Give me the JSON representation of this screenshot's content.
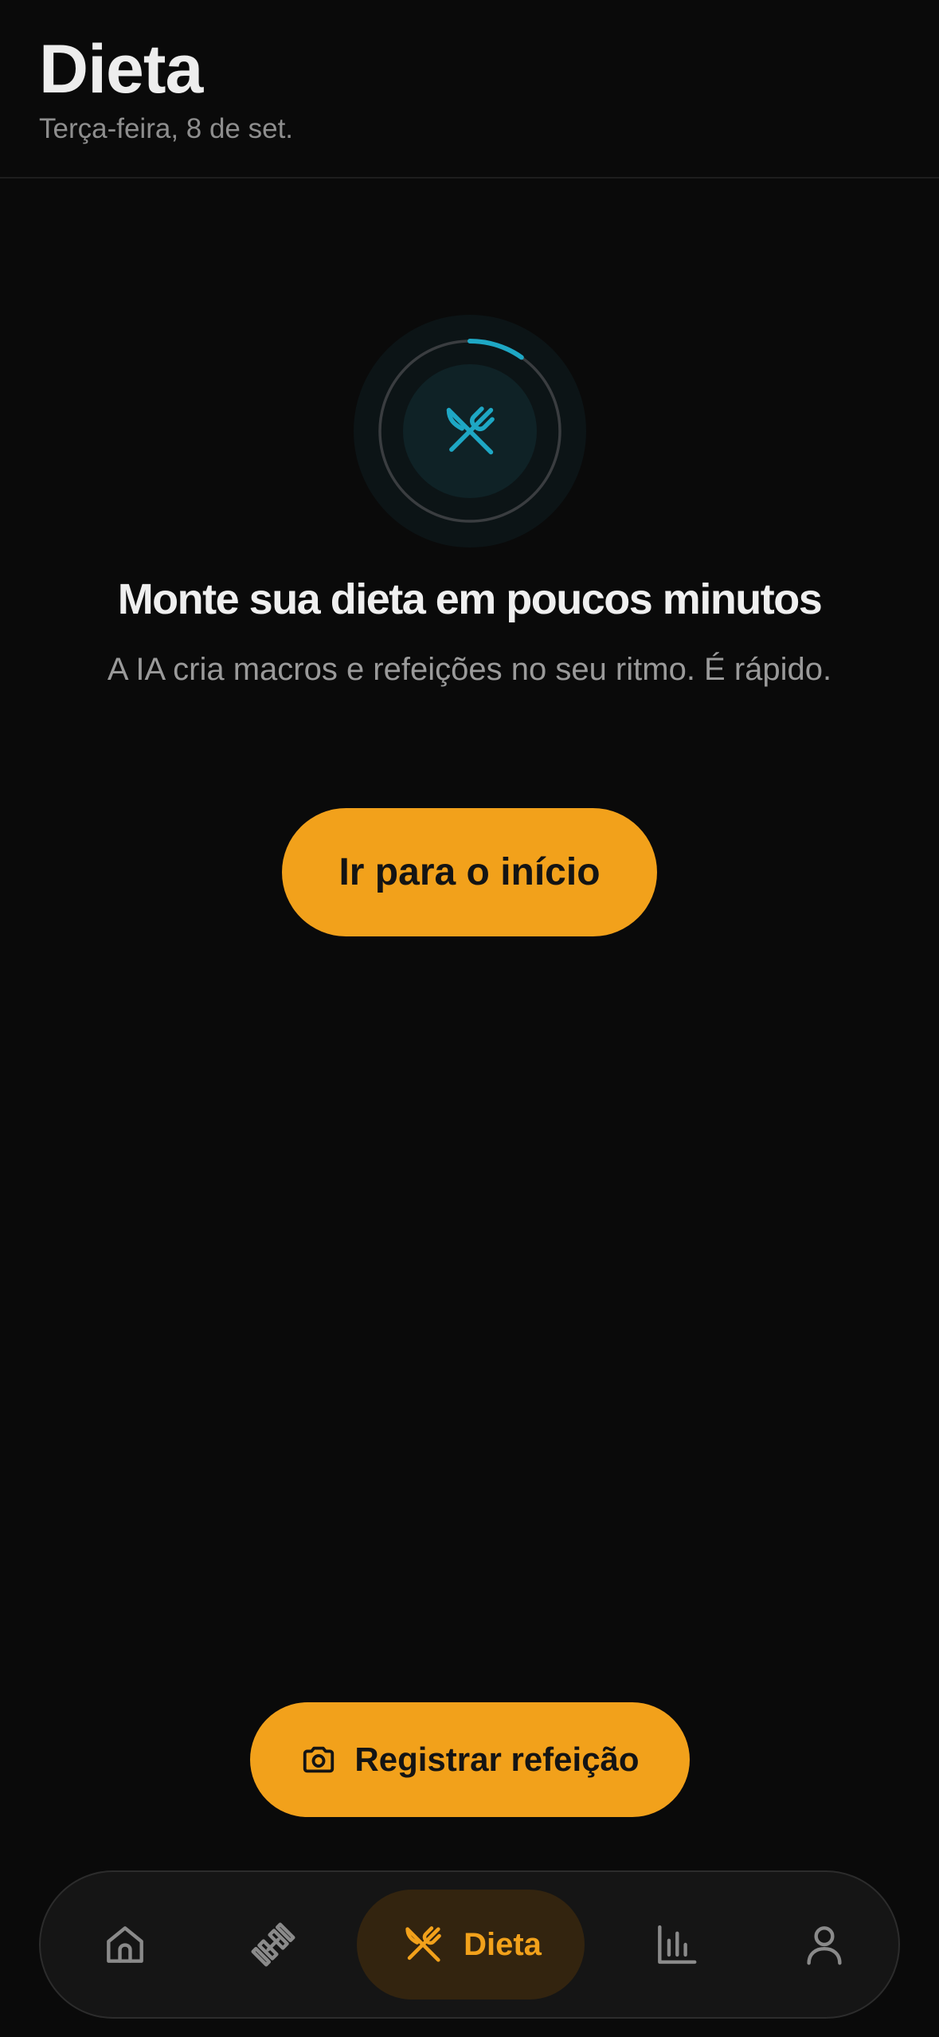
{
  "header": {
    "title": "Dieta",
    "subtitle": "Terça-feira, 8 de set."
  },
  "empty_state": {
    "icon": "fork-knife-icon",
    "headline": "Monte sua dieta em poucos minutos",
    "description": "A IA cria macros e refeições no seu ritmo. É rápido.",
    "button_label": "Ir para o início"
  },
  "fab": {
    "icon": "camera-icon",
    "label": "Registrar refeição"
  },
  "tabbar": {
    "items": [
      {
        "id": "home",
        "icon": "home-icon",
        "label": ""
      },
      {
        "id": "workout",
        "icon": "dumbbell-icon",
        "label": ""
      },
      {
        "id": "diet",
        "icon": "fork-knife-icon",
        "label": "Dieta",
        "active": true
      },
      {
        "id": "stats",
        "icon": "bar-chart-icon",
        "label": ""
      },
      {
        "id": "profile",
        "icon": "user-icon",
        "label": ""
      }
    ]
  },
  "colors": {
    "background": "#0a0a0a",
    "accent": "#f2a11b",
    "loader_accent": "#1ea7c4",
    "active_tab_bg": "#33240f"
  }
}
